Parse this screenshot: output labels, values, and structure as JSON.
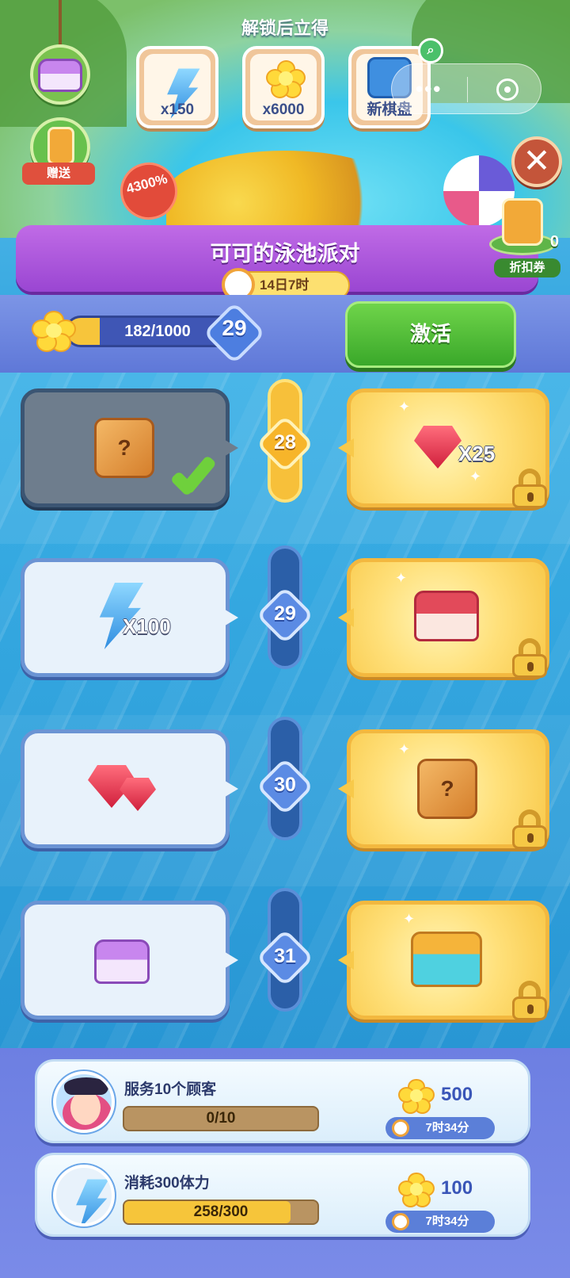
{
  "header": {
    "unlock_title": "解锁后立得",
    "rewards": [
      {
        "icon": "lightning-icon",
        "label": "x150"
      },
      {
        "icon": "flower-icon",
        "label": "x6000"
      },
      {
        "icon": "board-icon",
        "label": "新棋盘"
      }
    ],
    "gift_label": "赠送",
    "bonus_percent": "4300%",
    "coupon": {
      "count": "0",
      "label": "折扣券"
    }
  },
  "event": {
    "title": "可可的泳池派对",
    "time_left": "14日7时"
  },
  "progress": {
    "text": "182/1000",
    "fraction": 0.182,
    "level": "29",
    "activate_label": "激活"
  },
  "levels": [
    {
      "level": "28",
      "reached": true,
      "free": {
        "item": "mystery-box-icon",
        "qty": "",
        "claimed": true
      },
      "premium": {
        "item": "ruby-icon",
        "qty": "X25",
        "locked": true
      }
    },
    {
      "level": "29",
      "reached": false,
      "free": {
        "item": "lightning-icon",
        "qty": "X100",
        "claimed": false
      },
      "premium": {
        "item": "red-chest-icon",
        "qty": "",
        "locked": true
      }
    },
    {
      "level": "30",
      "reached": false,
      "free": {
        "item": "rubies-icon",
        "qty": "",
        "claimed": false
      },
      "premium": {
        "item": "mystery-box-icon",
        "qty": "",
        "locked": true
      }
    },
    {
      "level": "31",
      "reached": false,
      "free": {
        "item": "purple-chest-icon",
        "qty": "",
        "claimed": false
      },
      "premium": {
        "item": "treasure-chest-icon",
        "qty": "",
        "locked": true
      }
    }
  ],
  "tasks": [
    {
      "text": "服务10个顾客",
      "progress_text": "0/10",
      "fraction": 0.0,
      "reward": "500",
      "timer": "7时34分"
    },
    {
      "text": "消耗300体力",
      "progress_text": "258/300",
      "fraction": 0.86,
      "reward": "100",
      "timer": "7时34分"
    }
  ],
  "colors": {
    "banner": "#9a46d2",
    "activate": "#3aa82a",
    "premium_card": "#f8c94a",
    "free_card_border": "#6b94d4"
  }
}
